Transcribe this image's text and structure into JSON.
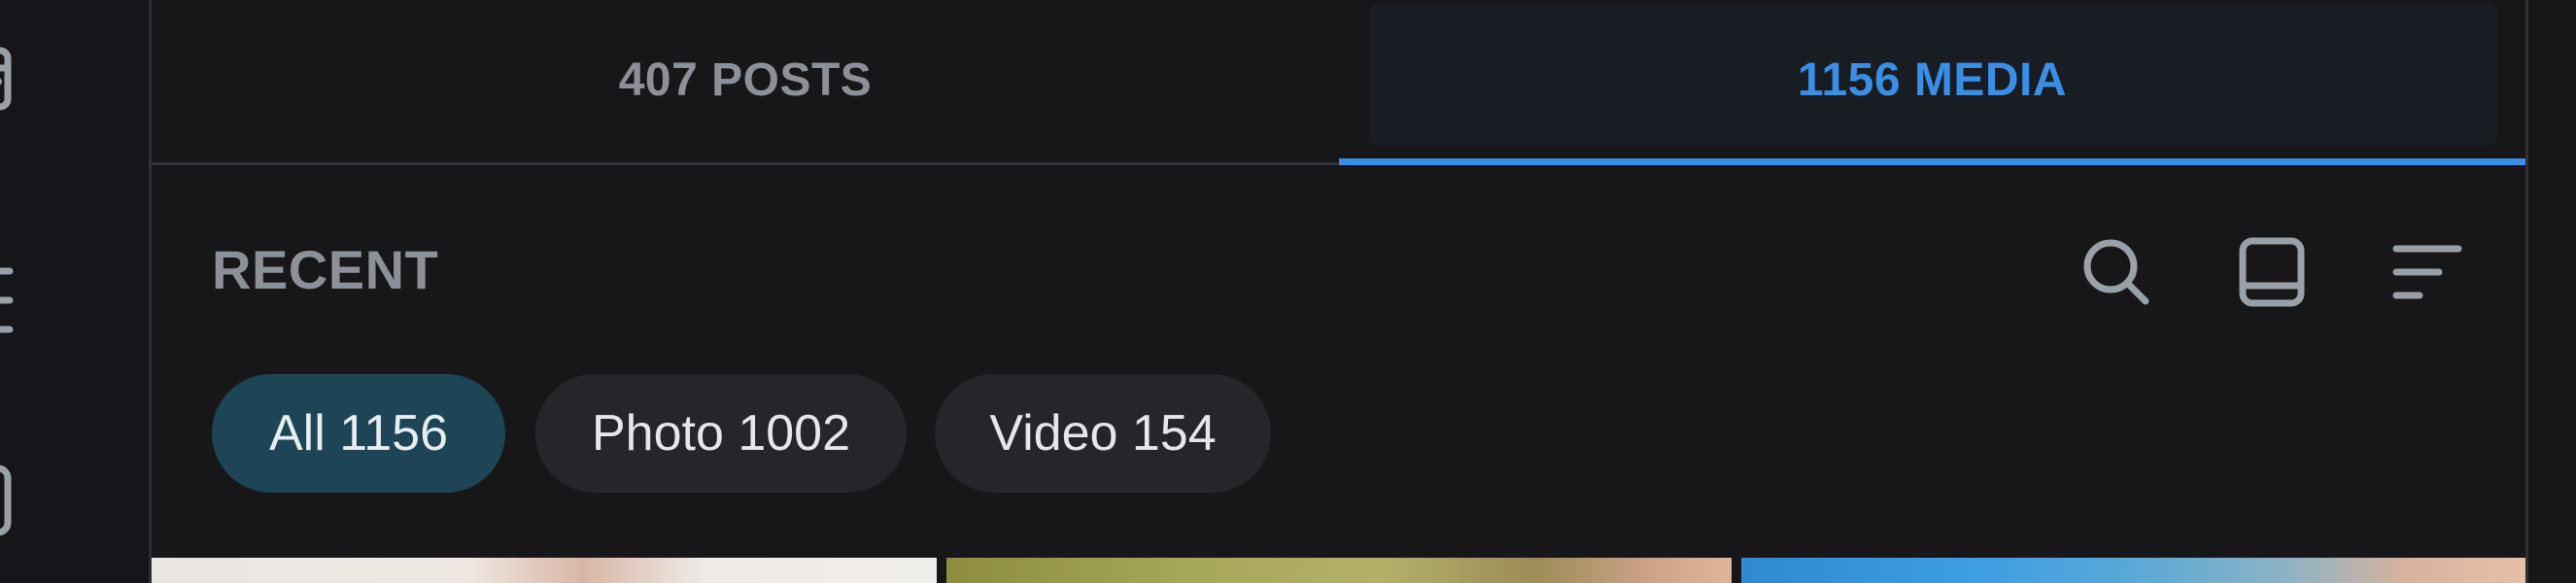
{
  "tabs": {
    "posts_label": "407 POSTS",
    "media_label": "1156 MEDIA"
  },
  "section": {
    "title": "RECENT"
  },
  "toolbar": {
    "search_icon": "search-icon",
    "layout_icon": "layout-icon",
    "sort_icon": "sort-icon"
  },
  "filters": {
    "all_label": "All 1156",
    "photo_label": "Photo 1002",
    "video_label": "Video 154"
  },
  "left_rail": {
    "icons": [
      "calendar-icon",
      "menu-icon",
      "statistics-icon"
    ]
  },
  "colors": {
    "background": "#17171a",
    "accent": "#3a8ee6",
    "muted_text": "#8b9099",
    "chip_bg": "#25262a",
    "chip_active_bg": "#1d4556"
  }
}
